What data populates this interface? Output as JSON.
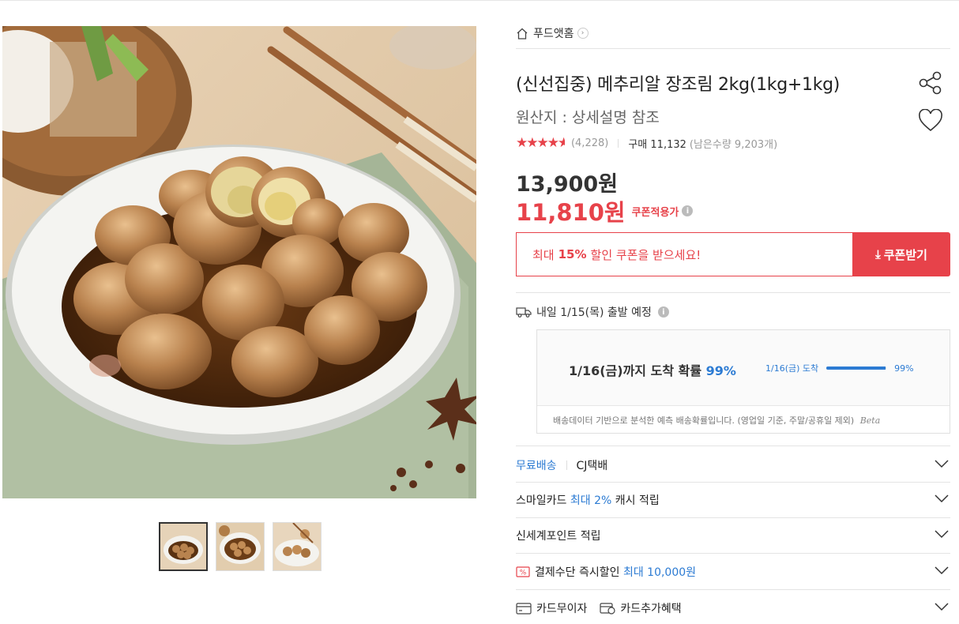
{
  "store": {
    "name": "푸드앳홈"
  },
  "product": {
    "title": "(신선집중) 메추리알 장조림 2kg(1kg+1kg)",
    "origin": "원산지 : 상세설명 참조",
    "rating": 4.5,
    "review_count": "(4,228)",
    "purchase": "구매 11,132",
    "remaining": "(남은수량 9,203개)",
    "original_price": "13,900원",
    "sale_price": "11,810원",
    "coupon_note": "쿠폰적용가",
    "info_mark": "i"
  },
  "coupon": {
    "pre": "최대",
    "pct": "15%",
    "post": "할인 쿠폰을 받으세요!",
    "button": "쿠폰받기"
  },
  "shipping": {
    "head": "내일 1/15(목) 출발 예정",
    "arrive_text": "1/16(금)까지 도착 확률",
    "arrive_pct": "99%",
    "bar_label": "1/16(금) 도착",
    "bar_value": "99%",
    "bar_fraction": 0.99,
    "note": "배송데이터 기반으로 분석한 예측 배송확률입니다. (영업일 기준, 주말/공휴일 제외)",
    "beta": "Beta"
  },
  "benefits": {
    "free_ship": "무료배송",
    "carrier": "CJ택배",
    "smile_pre": "스마일카드",
    "smile_blue": "최대 2%",
    "smile_post": "캐시 적립",
    "ssg_point": "신세계포인트 적립",
    "pay_pre": "결제수단 즉시할인",
    "pay_blue": "최대 10,000원",
    "installment": "카드무이자",
    "card_extra": "카드추가혜택"
  },
  "colors": {
    "accent": "#e7424a",
    "link": "#2c7bd3"
  }
}
